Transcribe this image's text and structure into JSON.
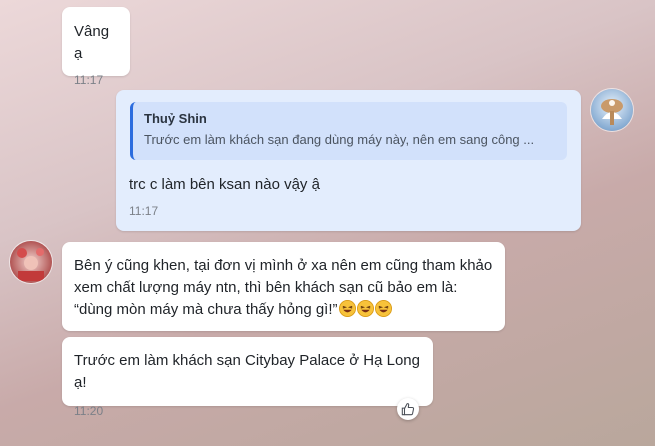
{
  "messages": [
    {
      "text": "Vâng ạ",
      "time": "11:17"
    },
    {
      "quote_name": "Thuỷ Shin",
      "quote_text": "Trước em làm khách sạn đang dùng máy này, nên em sang công ...",
      "text": "trc c làm bên ksan nào vậy ậ",
      "time": "11:17"
    },
    {
      "line1": "Bên ý cũng khen, tại đơn vị mình ở xa nên em cũng tham khảo",
      "line2": "xem chất lượng máy ntn, thì bên khách sạn cũ bảo em là:",
      "line3": "“dùng mòn máy mà chưa thấy hỏng gì!”"
    },
    {
      "text": "Trước em làm khách sạn Citybay Palace ở Hạ Long ạ!",
      "time": "11:20"
    }
  ],
  "icons": {
    "emoji": "laughing-emoji",
    "reaction": "thumbs-up-icon"
  },
  "colors": {
    "mine_bubble": "#e3edfd",
    "quote_bar": "#2b6cde"
  }
}
